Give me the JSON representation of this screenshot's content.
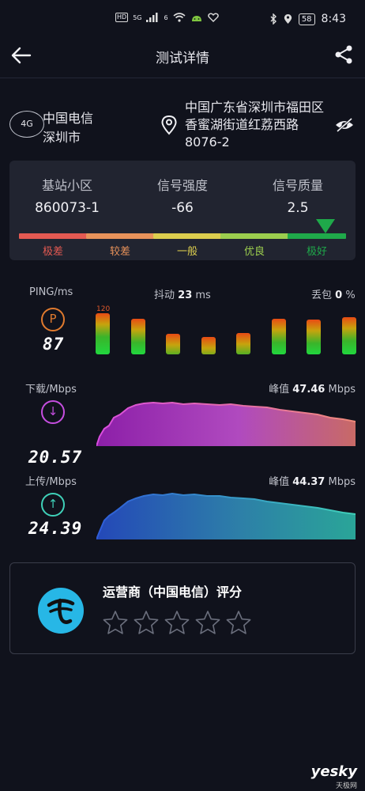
{
  "status_bar": {
    "time": "8:43",
    "battery": "58",
    "hd_label": "HD",
    "net_label": "5G",
    "wifi_label": "6"
  },
  "header": {
    "title": "测试详情"
  },
  "location": {
    "network_type": "4G",
    "operator": "中国电信",
    "city": "深圳市",
    "address": "中国广东省深圳市福田区香蜜湖街道红荔西路8076-2"
  },
  "signal": {
    "columns": [
      {
        "label": "基站小区",
        "value": "860073-1"
      },
      {
        "label": "信号强度",
        "value": "-66"
      },
      {
        "label": "信号质量",
        "value": "2.5"
      }
    ],
    "levels": [
      {
        "label": "极差",
        "color": "#e45a52"
      },
      {
        "label": "较差",
        "color": "#e8925a"
      },
      {
        "label": "一般",
        "color": "#dccd4e"
      },
      {
        "label": "优良",
        "color": "#9cce4e"
      },
      {
        "label": "极好",
        "color": "#1fa94a"
      }
    ],
    "current_level": "极好"
  },
  "ping": {
    "label": "PING/ms",
    "jitter_label": "抖动",
    "jitter_value": "23",
    "jitter_unit": "ms",
    "loss_label": "丢包",
    "loss_value": "0",
    "loss_unit": "%",
    "icon_letter": "P",
    "value": "87",
    "scale_label": "120",
    "samples_ms": [
      120,
      104,
      60,
      50,
      62,
      104,
      102,
      108
    ]
  },
  "download": {
    "label": "下载/Mbps",
    "value": "20.57",
    "peak_label": "峰值",
    "peak_value": "47.46",
    "peak_unit": "Mbps",
    "color_from": "#d94de0",
    "color_to": "#f08a7a"
  },
  "upload": {
    "label": "上传/Mbps",
    "value": "24.39",
    "peak_label": "峰值",
    "peak_value": "44.37",
    "peak_unit": "Mbps",
    "color_from": "#2f5cd8",
    "color_to": "#3fd0b8"
  },
  "rating": {
    "title": "运营商（中国电信）评分",
    "star_count": 5,
    "selected": 0
  },
  "watermark": {
    "brand": "yesky",
    "sub": "天极网"
  }
}
